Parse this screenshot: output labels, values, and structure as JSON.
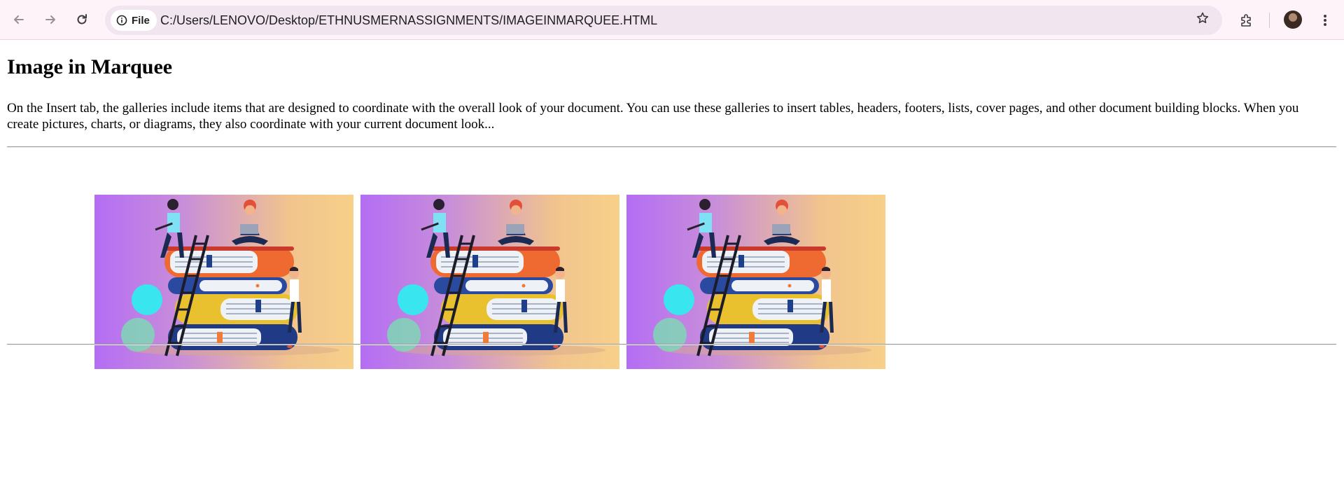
{
  "browser": {
    "site_chip_label": "File",
    "url": "C:/Users/LENOVO/Desktop/ETHNUSMERNASSIGNMENTS/IMAGEINMARQUEE.HTML",
    "icons": [
      "back-arrow-icon",
      "forward-arrow-icon",
      "reload-icon",
      "info-icon",
      "star-icon",
      "extensions-icon",
      "profile-avatar",
      "more-menu-icon"
    ]
  },
  "page": {
    "heading": "Image in Marquee",
    "paragraph": "On the Insert tab, the galleries include items that are designed to coordinate with the overall look of your document. You can use these galleries to insert tables, headers, footers, lists, cover pages, and other document building blocks. When you create pictures, charts, or diagrams, they also coordinate with your current document look...",
    "marquee_images": [
      {
        "name": "books-illustration-1"
      },
      {
        "name": "books-illustration-2"
      },
      {
        "name": "books-illustration-3"
      }
    ]
  }
}
